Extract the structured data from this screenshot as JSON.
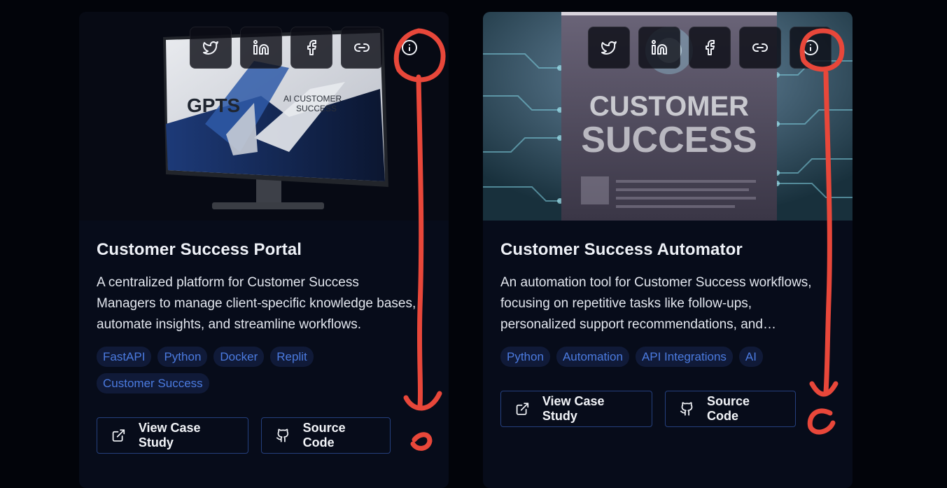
{
  "cards": [
    {
      "title": "Customer Success Portal",
      "description": "A centralized platform for Customer Success Managers to manage client-specific knowledge bases, automate insights, and streamline workflows.",
      "tags": [
        "FastAPI",
        "Python",
        "Docker",
        "Replit",
        "Customer Success"
      ],
      "image_text": {
        "brand": "GPTS",
        "line1": "AI CUSTOMER",
        "line2": "SUCCESS"
      },
      "actions": {
        "case_study": "View Case Study",
        "source": "Source Code"
      },
      "share_icons": [
        "twitter-icon",
        "linkedin-icon",
        "facebook-icon",
        "link-icon",
        "info-icon"
      ]
    },
    {
      "title": "Customer Success Automator",
      "description": "An automation tool for Customer Success workflows, focusing on repetitive tasks like follow-ups, personalized support recommendations, and automated reporting.",
      "tags": [
        "Python",
        "Automation",
        "API Integrations",
        "AI"
      ],
      "image_text": {
        "line1": "CUSTOMER",
        "line2": "SUCCESS"
      },
      "actions": {
        "case_study": "View Case Study",
        "source": "Source Code"
      },
      "share_icons": [
        "twitter-icon",
        "linkedin-icon",
        "facebook-icon",
        "link-icon",
        "info-icon"
      ]
    }
  ],
  "colors": {
    "page_background": "#02040a",
    "card_background": "#070c1a",
    "tag_background": "#101a38",
    "tag_text": "#4b7be0",
    "button_border": "#25407e",
    "annotation": "#e8473a"
  }
}
